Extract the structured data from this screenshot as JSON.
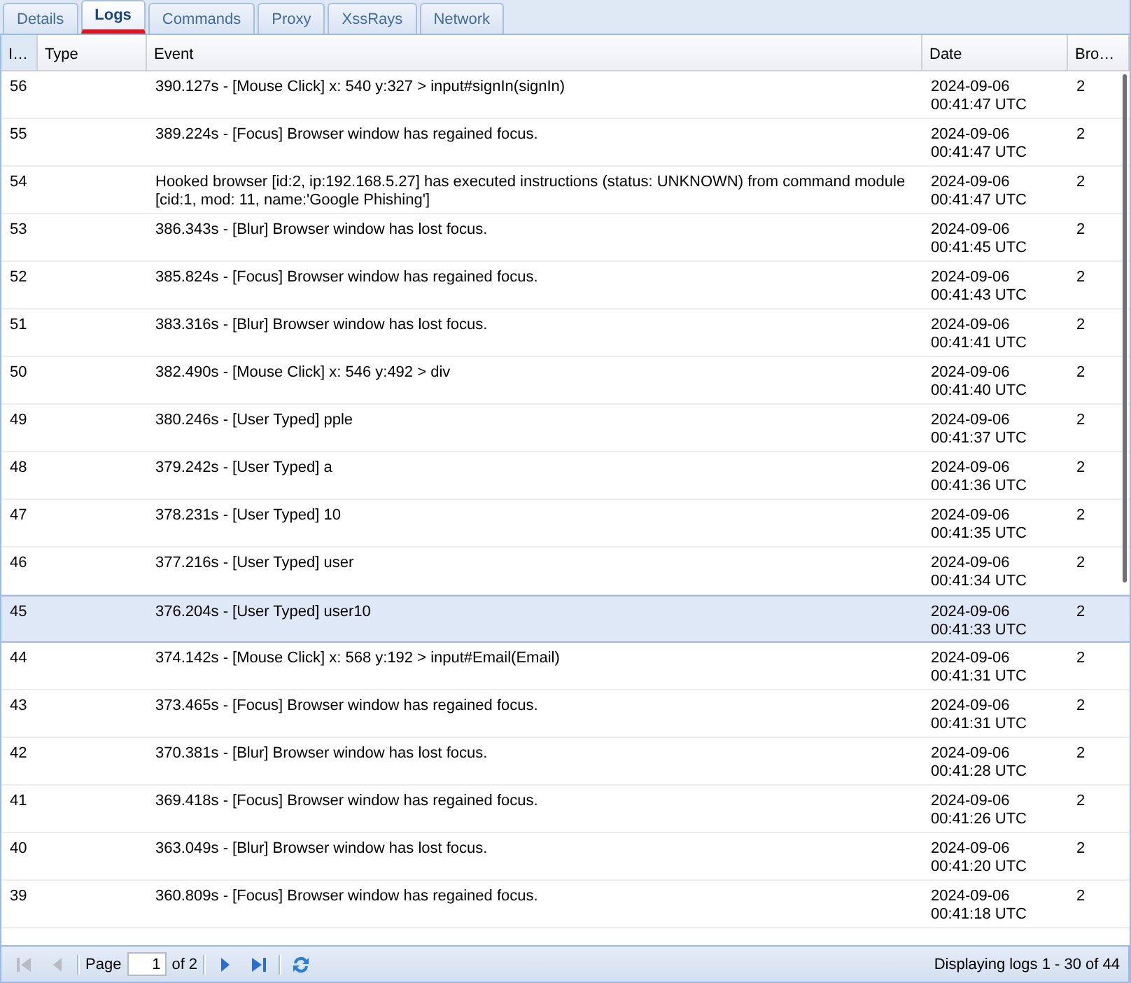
{
  "tabs": [
    {
      "label": "Details",
      "selected": false
    },
    {
      "label": "Logs",
      "selected": true
    },
    {
      "label": "Commands",
      "selected": false
    },
    {
      "label": "Proxy",
      "selected": false
    },
    {
      "label": "XssRays",
      "selected": false
    },
    {
      "label": "Network",
      "selected": false
    }
  ],
  "table": {
    "columns": [
      "I…",
      "Type",
      "Event",
      "Date",
      "Bro…"
    ],
    "rows": [
      {
        "id": "56",
        "event": "390.127s - [Mouse Click] x: 540 y:327 > input#signIn(signIn)",
        "date": "2024-09-06",
        "time": "00:41:47 UTC",
        "browser": "2",
        "selected": false
      },
      {
        "id": "55",
        "event": "389.224s - [Focus] Browser window has regained focus.",
        "date": "2024-09-06",
        "time": "00:41:47 UTC",
        "browser": "2",
        "selected": false
      },
      {
        "id": "54",
        "event": "Hooked browser [id:2, ip:192.168.5.27] has executed instructions (status: UNKNOWN) from command module [cid:1, mod: 11, name:'Google Phishing']",
        "date": "2024-09-06",
        "time": "00:41:47 UTC",
        "browser": "2",
        "selected": false
      },
      {
        "id": "53",
        "event": "386.343s - [Blur] Browser window has lost focus.",
        "date": "2024-09-06",
        "time": "00:41:45 UTC",
        "browser": "2",
        "selected": false
      },
      {
        "id": "52",
        "event": "385.824s - [Focus] Browser window has regained focus.",
        "date": "2024-09-06",
        "time": "00:41:43 UTC",
        "browser": "2",
        "selected": false
      },
      {
        "id": "51",
        "event": "383.316s - [Blur] Browser window has lost focus.",
        "date": "2024-09-06",
        "time": "00:41:41 UTC",
        "browser": "2",
        "selected": false
      },
      {
        "id": "50",
        "event": "382.490s - [Mouse Click] x: 546 y:492 > div",
        "date": "2024-09-06",
        "time": "00:41:40 UTC",
        "browser": "2",
        "selected": false
      },
      {
        "id": "49",
        "event": "380.246s - [User Typed] pple",
        "date": "2024-09-06",
        "time": "00:41:37 UTC",
        "browser": "2",
        "selected": false
      },
      {
        "id": "48",
        "event": "379.242s - [User Typed] a",
        "date": "2024-09-06",
        "time": "00:41:36 UTC",
        "browser": "2",
        "selected": false
      },
      {
        "id": "47",
        "event": "378.231s - [User Typed] 10",
        "date": "2024-09-06",
        "time": "00:41:35 UTC",
        "browser": "2",
        "selected": false
      },
      {
        "id": "46",
        "event": "377.216s - [User Typed] user",
        "date": "2024-09-06",
        "time": "00:41:34 UTC",
        "browser": "2",
        "selected": false
      },
      {
        "id": "45",
        "event": "376.204s - [User Typed] user10",
        "date": "2024-09-06",
        "time": "00:41:33 UTC",
        "browser": "2",
        "selected": true
      },
      {
        "id": "44",
        "event": "374.142s - [Mouse Click] x: 568 y:192 > input#Email(Email)",
        "date": "2024-09-06",
        "time": "00:41:31 UTC",
        "browser": "2",
        "selected": false
      },
      {
        "id": "43",
        "event": "373.465s - [Focus] Browser window has regained focus.",
        "date": "2024-09-06",
        "time": "00:41:31 UTC",
        "browser": "2",
        "selected": false
      },
      {
        "id": "42",
        "event": "370.381s - [Blur] Browser window has lost focus.",
        "date": "2024-09-06",
        "time": "00:41:28 UTC",
        "browser": "2",
        "selected": false
      },
      {
        "id": "41",
        "event": "369.418s - [Focus] Browser window has regained focus.",
        "date": "2024-09-06",
        "time": "00:41:26 UTC",
        "browser": "2",
        "selected": false
      },
      {
        "id": "40",
        "event": "363.049s - [Blur] Browser window has lost focus.",
        "date": "2024-09-06",
        "time": "00:41:20 UTC",
        "browser": "2",
        "selected": false
      },
      {
        "id": "39",
        "event": "360.809s - [Focus] Browser window has regained focus.",
        "date": "2024-09-06",
        "time": "00:41:18 UTC",
        "browser": "2",
        "selected": false
      }
    ]
  },
  "pager": {
    "page_label": "Page",
    "page": "1",
    "of": "of 2",
    "status": "Displaying logs 1 - 30 of 44"
  }
}
